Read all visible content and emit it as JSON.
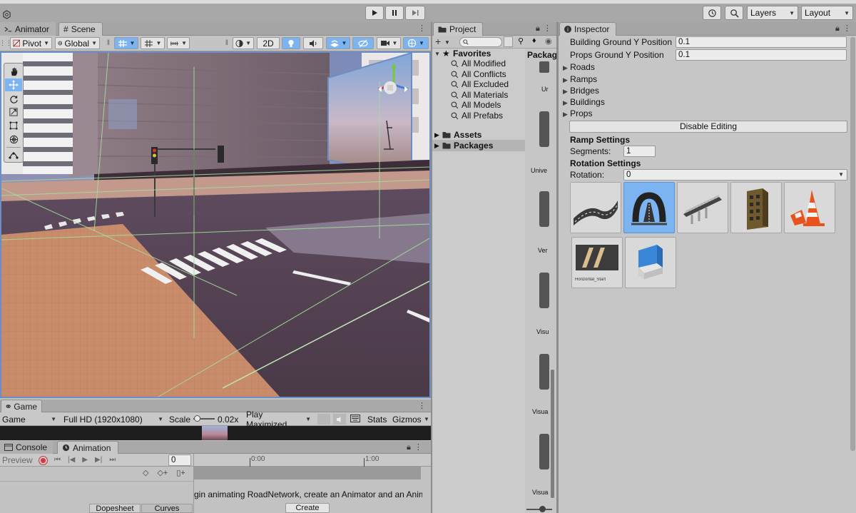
{
  "toolbar": {
    "layers_label": "Layers",
    "layout_label": "Layout"
  },
  "scene_tabs": [
    {
      "label": "Animator"
    },
    {
      "label": "Scene"
    }
  ],
  "scene_toolbar": {
    "pivot_label": "Pivot",
    "global_label": "Global",
    "mode_2d_label": "2D"
  },
  "game": {
    "tab_label": "Game",
    "display_label": "Game",
    "resolution_label": "Full HD (1920x1080)",
    "scale_label": "Scale",
    "scale_value": "0.02x",
    "play_mode_label": "Play Maximized",
    "stats_label": "Stats",
    "gizmos_label": "Gizmos"
  },
  "animation": {
    "console_tab": "Console",
    "animation_tab": "Animation",
    "preview_label": "Preview",
    "frame_value": "0",
    "time_markers": [
      "0:00",
      "1:00"
    ],
    "message": "gin animating RoadNetwork, create an Animator and an Animatic",
    "create_label": "Create",
    "dopesheet_label": "Dopesheet",
    "curves_label": "Curves"
  },
  "project": {
    "tab_label": "Project",
    "grid_header": "Packag",
    "favorites_label": "Favorites",
    "favorites": [
      "All Modified",
      "All Conflicts",
      "All Excluded",
      "All Materials",
      "All Models",
      "All Prefabs"
    ],
    "assets_label": "Assets",
    "packages_label": "Packages",
    "grid_labels": [
      "Ur",
      "Unive",
      "Ver",
      "Visu",
      "Visua",
      "Visua"
    ]
  },
  "inspector": {
    "tab_label": "Inspector",
    "building_ground_label": "Building Ground Y Position",
    "building_ground_value": "0.1",
    "props_ground_label": "Props Ground Y Position",
    "props_ground_value": "0.1",
    "foldouts": [
      "Roads",
      "Ramps",
      "Bridges",
      "Buildings",
      "Props"
    ],
    "disable_editing_label": "Disable Editing",
    "ramp_settings_label": "Ramp Settings",
    "segments_label": "Segments:",
    "segments_value": "1",
    "rotation_settings_label": "Rotation Settings",
    "rotation_label": "Rotation:",
    "rotation_value": "0",
    "thumbnails": [
      "road-piece",
      "ramp",
      "bridge",
      "building",
      "traffic-cones",
      "crosswalk-road",
      "eraser"
    ],
    "selected_thumbnail": "ramp",
    "crosswalk_caption": "Horizontal_Start"
  },
  "colors": {
    "accent": "#7cb4f2",
    "record": "#d23a3a",
    "scene_border": "#6b8fc4"
  }
}
